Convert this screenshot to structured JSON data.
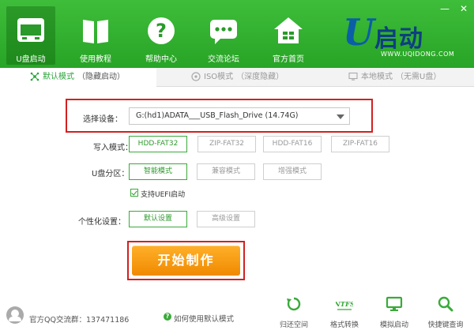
{
  "window": {
    "minimize_glyph": "—",
    "close_glyph": "✕"
  },
  "nav": [
    {
      "label": "U盘启动",
      "icon": "window-icon",
      "active": true
    },
    {
      "label": "使用教程",
      "icon": "book-icon"
    },
    {
      "label": "帮助中心",
      "icon": "help-icon"
    },
    {
      "label": "交流论坛",
      "icon": "chat-icon"
    },
    {
      "label": "官方首页",
      "icon": "home-icon"
    }
  ],
  "logo": {
    "letter": "U",
    "text": "启动",
    "url": "WWW.UQIDONG.COM"
  },
  "tabs": [
    {
      "label": "默认模式",
      "sub": "（隐藏启动）",
      "icon": "network-icon",
      "active": true
    },
    {
      "label": "ISO模式",
      "sub": "（深度隐藏）",
      "icon": "disc-icon"
    },
    {
      "label": "本地模式",
      "sub": "（无需U盘）",
      "icon": "monitor-icon"
    }
  ],
  "form": {
    "device_label": "选择设备：",
    "device_value": "G:(hd1)ADATA___USB_Flash_Drive (14.74G)",
    "write_mode_label": "写入模式：",
    "write_modes": [
      "HDD-FAT32",
      "ZIP-FAT32",
      "HDD-FAT16",
      "ZIP-FAT16"
    ],
    "write_mode_selected": "HDD-FAT32",
    "partition_label": "U盘分区：",
    "partition_modes": [
      "智能模式",
      "兼容模式",
      "增强模式"
    ],
    "partition_selected": "智能模式",
    "uefi_label": "支持UEFI启动",
    "uefi_checked": true,
    "personal_label": "个性化设置：",
    "personal_options": [
      "默认设置",
      "高级设置"
    ],
    "personal_selected": "默认设置",
    "start_button": "开始制作"
  },
  "footer": {
    "qq_text": "官方QQ交流群：137471186",
    "help_text": "如何使用默认模式",
    "tools": [
      {
        "label": "归还空间",
        "icon": "restore-icon"
      },
      {
        "label": "格式转换",
        "icon": "ntfs-icon"
      },
      {
        "label": "模拟启动",
        "icon": "monitor-icon"
      },
      {
        "label": "快捷键查询",
        "icon": "search-icon"
      }
    ],
    "ntfs_glyph": "NTFS"
  },
  "colors": {
    "header_green": "#33b232",
    "accent_green": "#2ba33b",
    "start_orange": "#f39200",
    "highlight_red": "#d42020"
  }
}
